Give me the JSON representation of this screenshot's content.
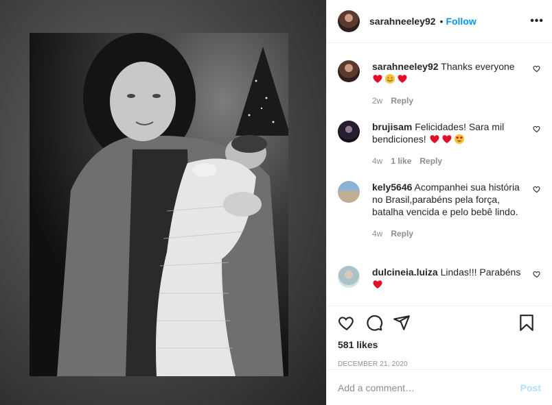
{
  "post": {
    "username": "sarahneeley92",
    "follow_label": "Follow",
    "separator": "•",
    "more_label": "•••",
    "likes": "581 likes",
    "date": "DECEMBER 21, 2020"
  },
  "comments": [
    {
      "username": "sarahneeley92",
      "text": "Thanks everyone",
      "emojis": [
        "red-heart",
        "smiling-face",
        "red-heart"
      ],
      "time": "2w",
      "likes": "",
      "reply_label": "Reply"
    },
    {
      "username": "brujisam",
      "text": "Felicidades! Sara mil bendiciones!",
      "emojis": [
        "red-heart",
        "red-heart",
        "heart-eyes"
      ],
      "time": "4w",
      "likes": "1 like",
      "reply_label": "Reply"
    },
    {
      "username": "kely5646",
      "text": "Acompanhei sua história no Brasil,parabéns pela força, batalha vencida e pelo bebê lindo.",
      "emojis": [],
      "time": "4w",
      "likes": "",
      "reply_label": "Reply"
    },
    {
      "username": "dulcineia.luiza",
      "text": "Lindas!!! Parabéns",
      "emojis": [
        "red-heart"
      ],
      "time": "",
      "likes": "",
      "reply_label": ""
    }
  ],
  "composer": {
    "placeholder": "Add a comment…",
    "post_label": "Post"
  },
  "colors": {
    "accent": "#0095f6",
    "post_disabled": "#b2dffc",
    "heart": "#ed4956"
  },
  "icons": [
    "heart-icon",
    "comment-icon",
    "share-icon",
    "bookmark-icon",
    "more-icon"
  ]
}
